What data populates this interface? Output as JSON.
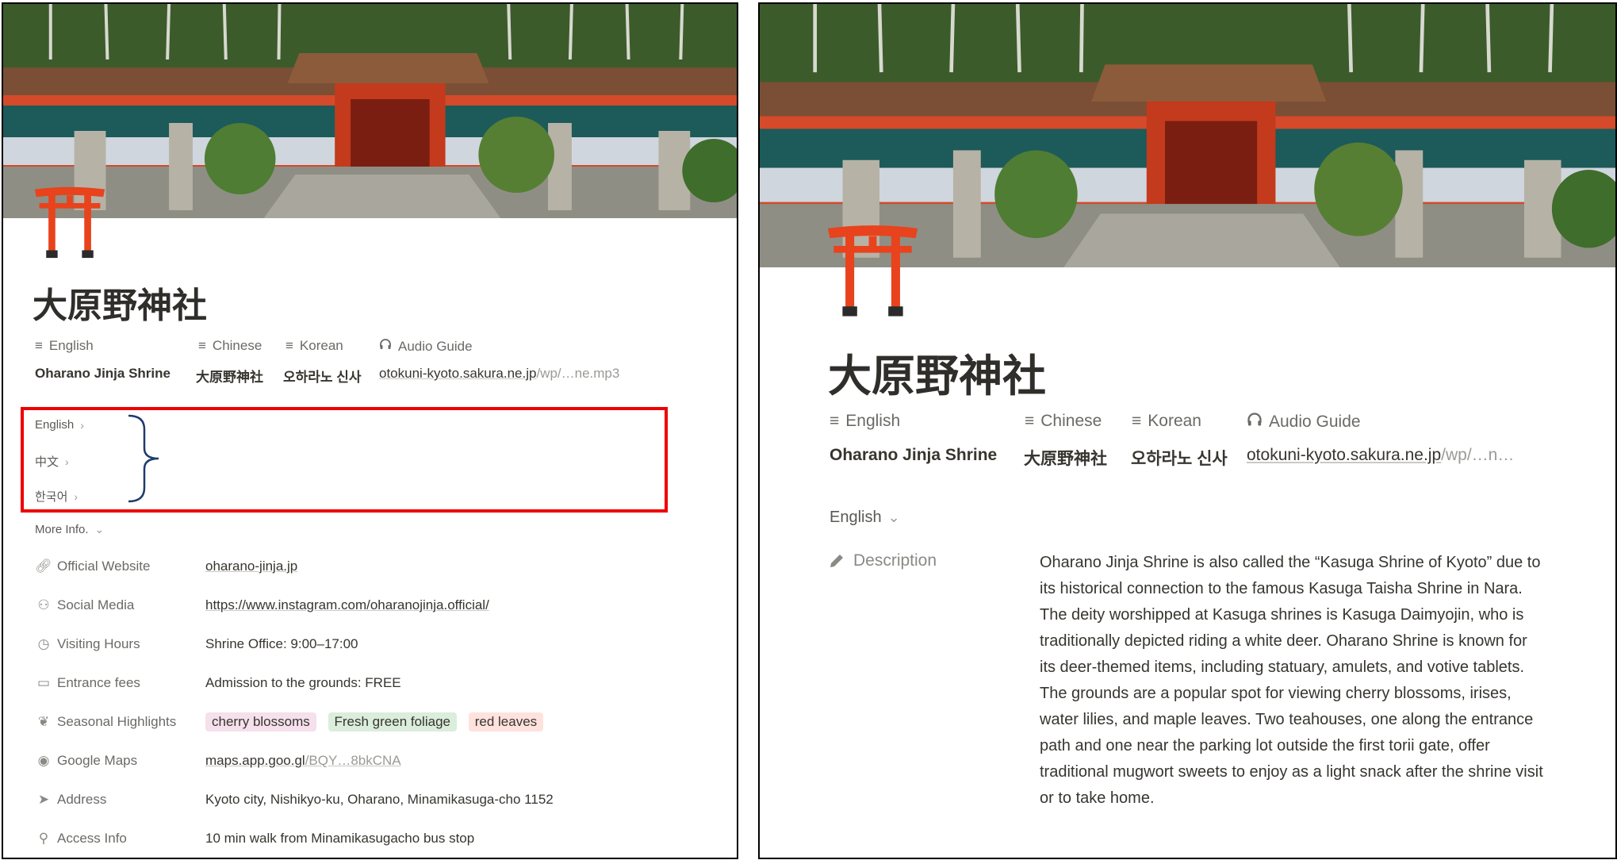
{
  "title": "大原野神社",
  "properties": {
    "english": {
      "label": "English",
      "value": "Oharano Jinja Shrine"
    },
    "chinese": {
      "label": "Chinese",
      "value": "大原野神社"
    },
    "korean": {
      "label": "Korean",
      "value": "오하라노 신사"
    },
    "audio": {
      "label": "Audio Guide",
      "value_main": "otokuni-kyoto.sakura.ne.jp",
      "value_tail_left": "/wp/…ne.mp3",
      "value_right": "otokuni-kyoto.sakura.ne.jp",
      "value_tail_right": "/wp/…n…"
    }
  },
  "toggles": {
    "english": "English",
    "chinese": "中文",
    "korean": "한국어",
    "more": "More Info."
  },
  "info": [
    {
      "label": "Official Website",
      "icon": "link-icon",
      "value": "oharano-jinja.jp"
    },
    {
      "label": "Social Media",
      "icon": "people-icon",
      "value": "https://www.instagram.com/oharanojinja.official/"
    },
    {
      "label": "Visiting Hours",
      "icon": "clock-icon",
      "value": "Shrine Office: 9:00–17:00"
    },
    {
      "label": "Entrance fees",
      "icon": "ticket-icon",
      "value": "Admission to the grounds: FREE"
    },
    {
      "label": "Seasonal Highlights",
      "icon": "leaf-icon",
      "tags": [
        "cherry blossoms",
        "Fresh green foliage",
        "red leaves"
      ]
    },
    {
      "label": "Google Maps",
      "icon": "compass-icon",
      "value": "maps.app.goo.gl",
      "value_tail": "/BQY…8bkCNA"
    },
    {
      "label": "Address",
      "icon": "location-arrow-icon",
      "value": "Kyoto city, Nishikyo-ku, Oharano, Minamikasuga-cho 1152"
    },
    {
      "label": "Access Info",
      "icon": "walk-icon",
      "value": "10 min walk from Minamikasugacho bus stop"
    }
  ],
  "tag_colors": {
    "pink": "#f5e0ec",
    "green": "#dbeddb",
    "red": "#ffe2dd"
  },
  "right_toggle": "English",
  "description": {
    "label": "Description",
    "text": "Oharano Jinja Shrine is also called the “Kasuga Shrine of Kyoto” due to its historical connection to the famous Kasuga Taisha Shrine in Nara. The deity worshipped at Kasuga shrines is Kasuga Daimyojin, who is traditionally depicted riding a white deer. Oharano Shrine is known for its deer-themed items, including statuary, amulets, and votive tablets. The grounds are a popular spot for viewing cherry blossoms, irises, water lilies, and maple leaves. Two teahouses, one along the entrance path and one near the parking lot outside the first torii gate, offer traditional mugwort sweets to enjoy as a light snack after the shrine visit or to take home."
  },
  "colors": {
    "annotation_box": "#ee0000",
    "torii": "#e8431c",
    "bracket": "#1f3b6e"
  }
}
